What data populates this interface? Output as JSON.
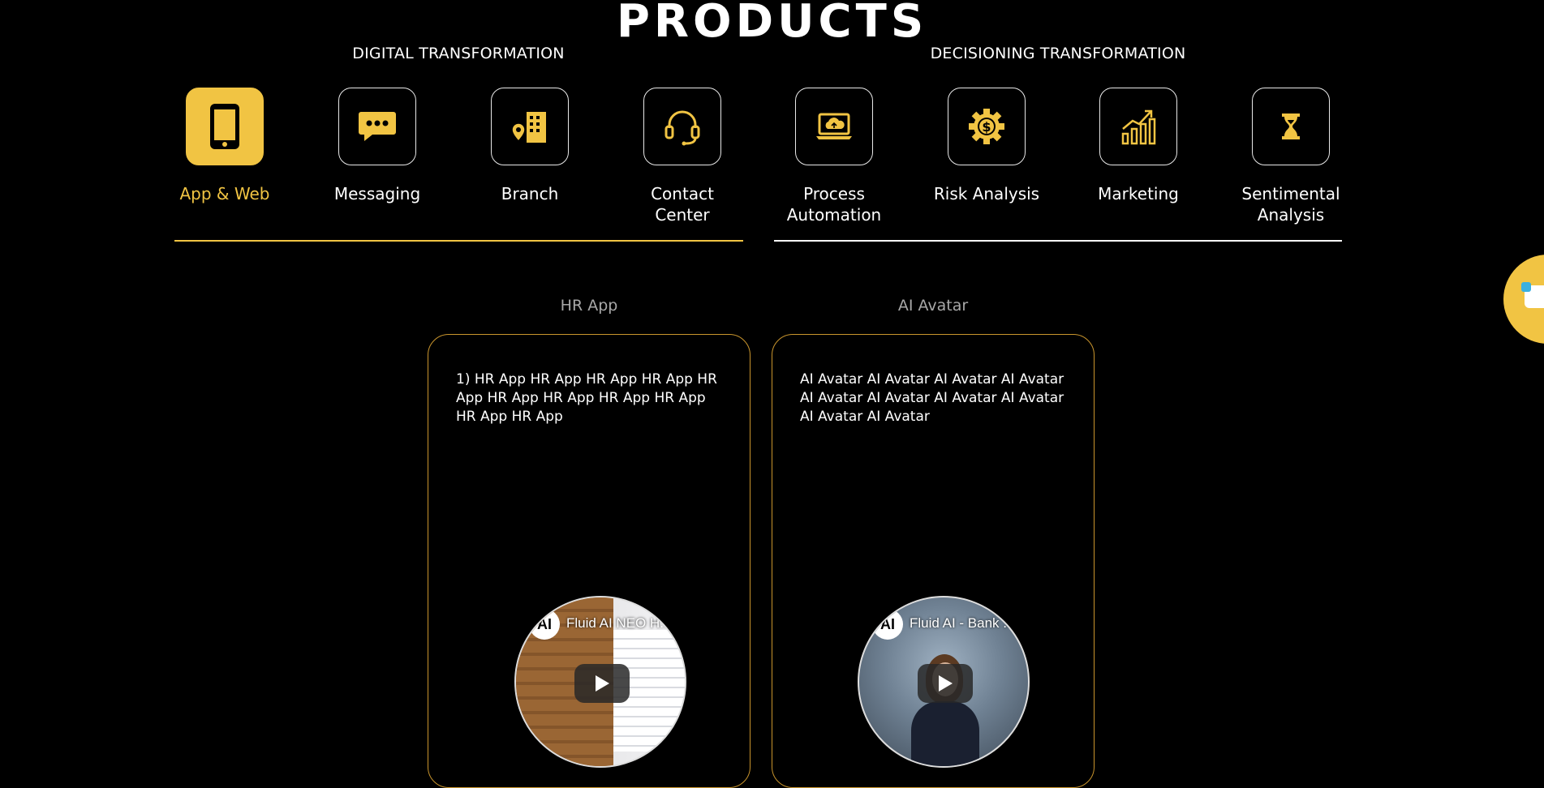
{
  "page": {
    "title": "PRODUCTS"
  },
  "groups": {
    "left": "DIGITAL TRANSFORMATION",
    "right": "DECISIONING TRANSFORMATION"
  },
  "tiles": [
    {
      "label": "App & Web",
      "icon": "smartphone-icon",
      "active": true
    },
    {
      "label": "Messaging",
      "icon": "chat-bubble-icon",
      "active": false
    },
    {
      "label": "Branch",
      "icon": "building-location-icon",
      "active": false
    },
    {
      "label": "Contact Center",
      "icon": "headset-icon",
      "active": false
    },
    {
      "label": "Process Automation",
      "icon": "laptop-cloud-icon",
      "active": false
    },
    {
      "label": "Risk Analysis",
      "icon": "dollar-gear-icon",
      "active": false
    },
    {
      "label": "Marketing",
      "icon": "growth-chart-icon",
      "active": false
    },
    {
      "label": "Sentimental Analysis",
      "icon": "hourglass-icon",
      "active": false
    }
  ],
  "cards": [
    {
      "title": "HR App",
      "description": "1) HR App HR App HR App HR App HR App HR App HR App HR App HR App HR App HR App",
      "video_title": "Fluid AI NEO H..."
    },
    {
      "title": "AI Avatar",
      "description": "AI Avatar AI Avatar AI Avatar AI Avatar AI Avatar AI Avatar AI Avatar AI Avatar AI Avatar AI Avatar",
      "video_title": "Fluid AI - Bank ..."
    }
  ],
  "colors": {
    "accent": "#f1c443",
    "card_border": "#c9952d",
    "background": "#000000"
  }
}
